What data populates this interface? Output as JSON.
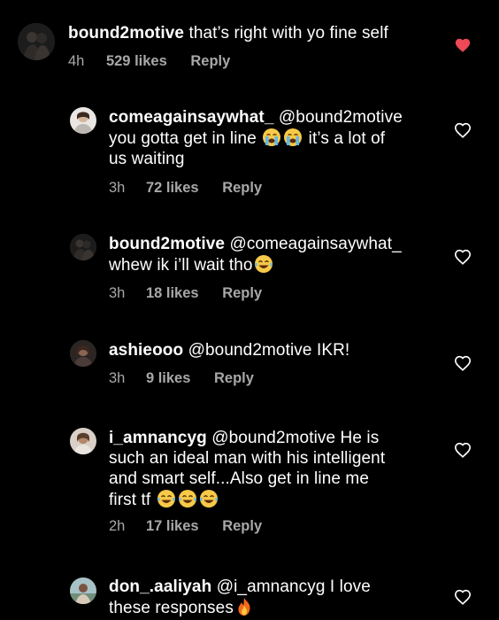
{
  "comments": [
    {
      "username": "bound2motive",
      "text": "that’s right with yo fine self",
      "time": "4h",
      "likes": "529 likes",
      "reply": "Reply",
      "liked": true
    },
    {
      "username": "comeagainsaywhat_",
      "line1": "@bound2motive",
      "line2a": "you gotta get in line",
      "line2b": "it’s a lot of",
      "line3": "us waiting",
      "time": "3h",
      "likes": "72 likes",
      "reply": "Reply",
      "liked": false
    },
    {
      "username": "bound2motive",
      "line1": "@comeagainsaywhat_",
      "line2": "whew ik i’ll wait tho",
      "time": "3h",
      "likes": "18 likes",
      "reply": "Reply",
      "liked": false
    },
    {
      "username": "ashieooo",
      "text": "@bound2motive IKR!",
      "time": "3h",
      "likes": "9 likes",
      "reply": "Reply",
      "liked": false
    },
    {
      "username": "i_amnancyg",
      "line1": "@bound2motive He is",
      "line2": "such an ideal man with his intelligent",
      "line3": "and smart self...Also get in line me",
      "line4": "first tf",
      "time": "2h",
      "likes": "17 likes",
      "reply": "Reply",
      "liked": false
    },
    {
      "username": "don_.aaliyah",
      "line1": "@i_amnancyg I love",
      "line2": "these responses",
      "liked": false
    }
  ],
  "colors": {
    "background": "#000000",
    "text": "#ffffff",
    "meta": "#a8a8a8",
    "liked_heart": "#ed4956",
    "outline_heart": "#ffffff"
  },
  "icons": {
    "like_filled": "heart-filled-icon",
    "like_outline": "heart-outline-icon",
    "crying": "loudly-crying-face-emoji",
    "laughing": "face-with-tears-of-joy-emoji",
    "fire": "fire-emoji"
  }
}
